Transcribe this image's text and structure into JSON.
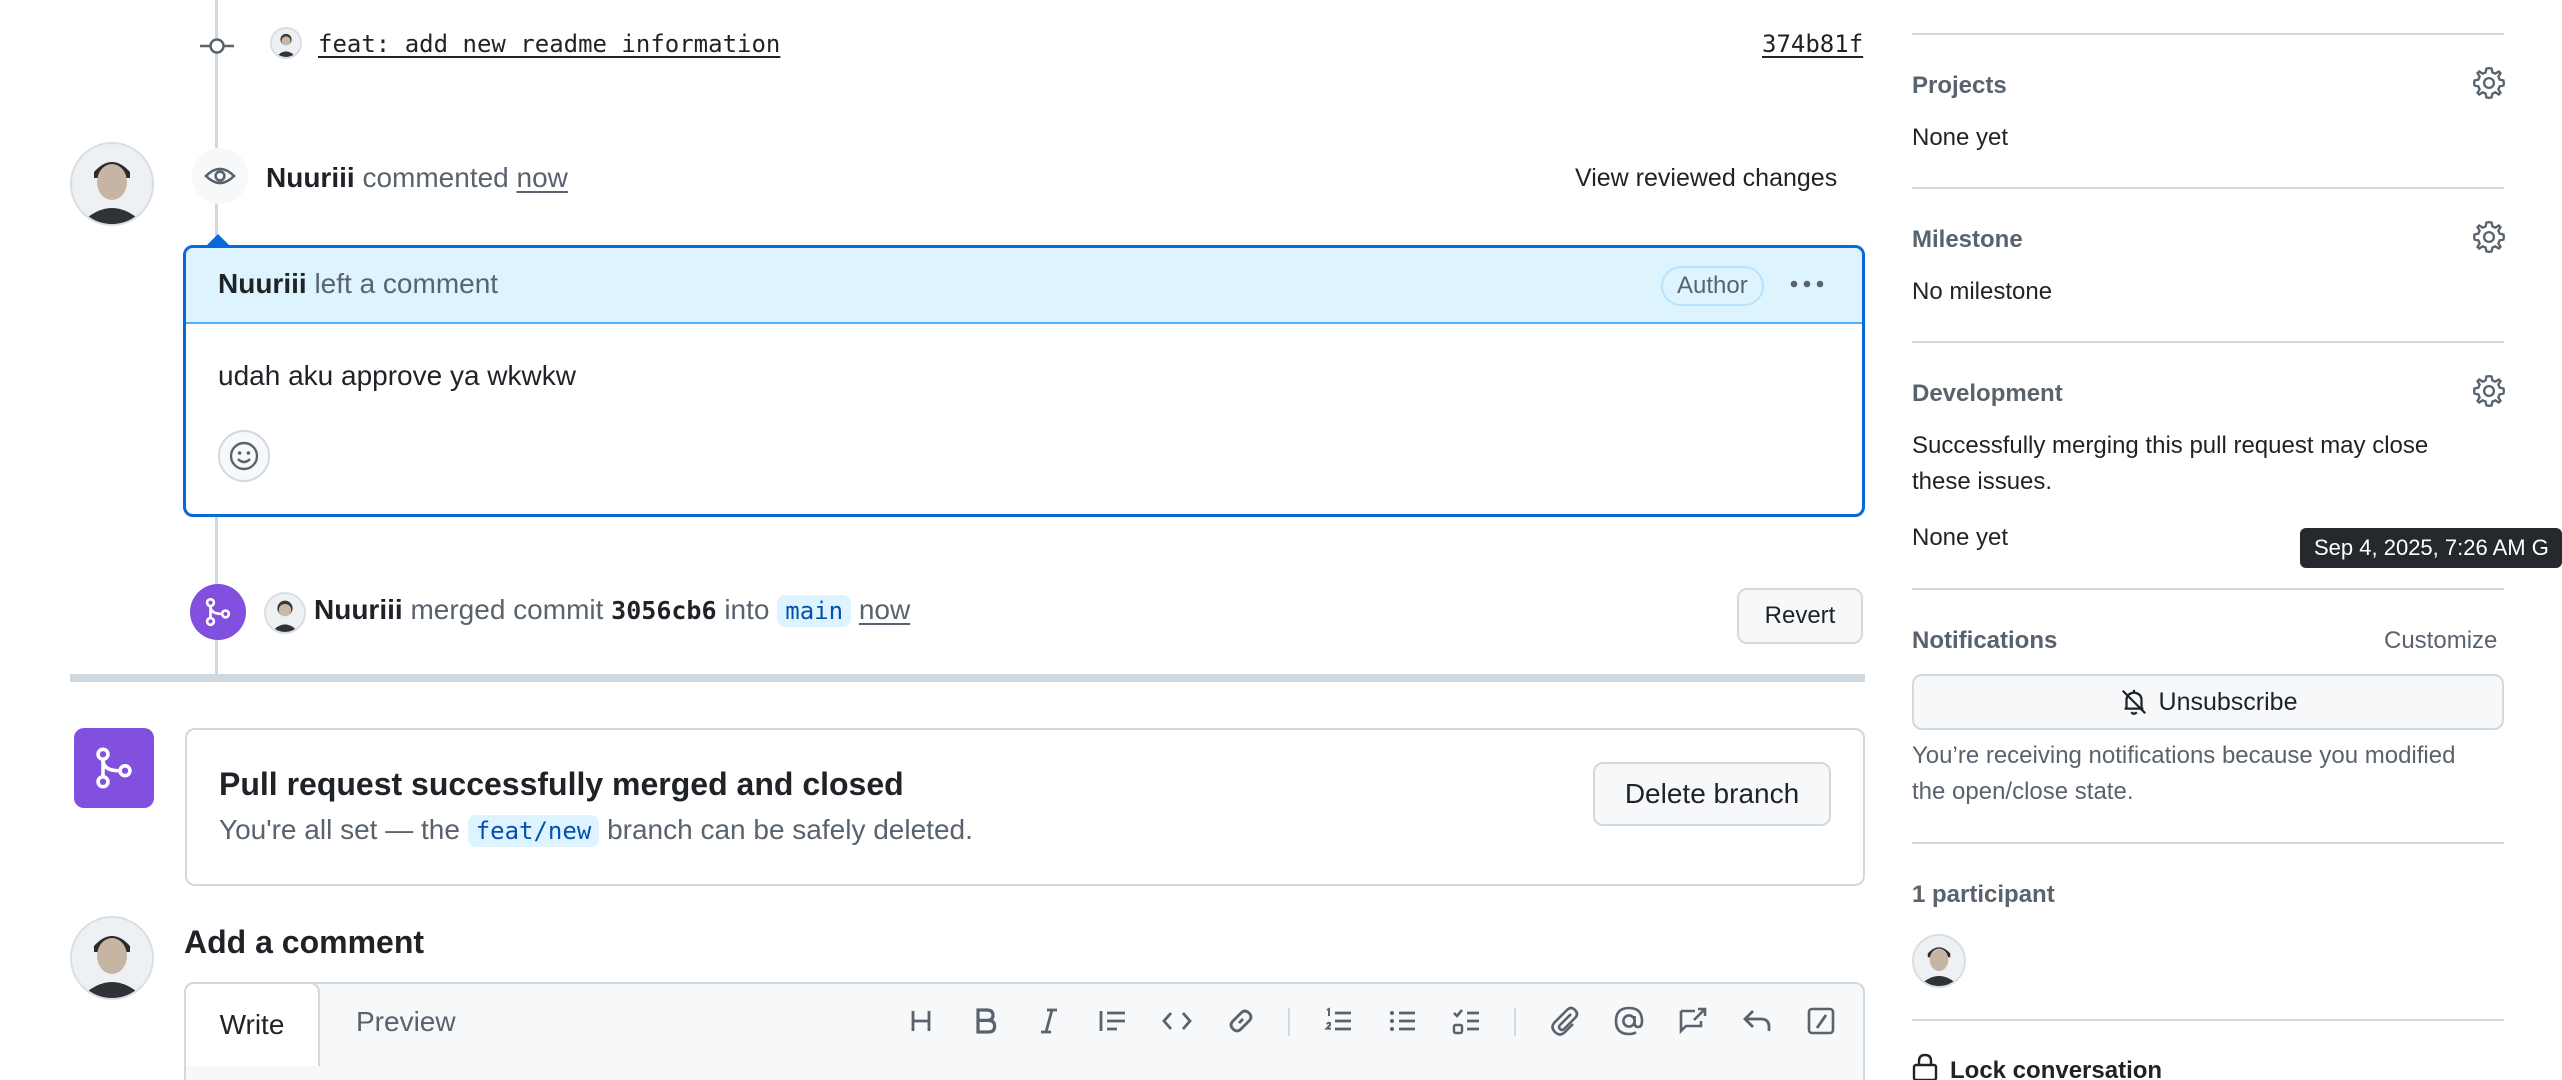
{
  "commit_row": {
    "message": "feat: add new readme information",
    "sha": "374b81f"
  },
  "review_event": {
    "author": "Nuuriii",
    "action": "commented",
    "time": "now",
    "view_changes_label": "View reviewed changes"
  },
  "comment": {
    "author": "Nuuriii",
    "header_suffix": "left a comment",
    "role_badge": "Author",
    "body": "udah aku approve ya wkwkw"
  },
  "merge_event": {
    "author": "Nuuriii",
    "action": "merged commit",
    "commit": "3056cb6",
    "into": "into",
    "branch": "main",
    "time": "now",
    "revert_label": "Revert"
  },
  "merged_box": {
    "title": "Pull request successfully merged and closed",
    "text_before": "You're all set — the",
    "branch": "feat/new",
    "text_after": "branch can be safely deleted.",
    "delete_label": "Delete branch"
  },
  "add_comment": {
    "title": "Add a comment",
    "tab_write": "Write",
    "tab_preview": "Preview"
  },
  "toolbar_icons": [
    "heading-icon",
    "bold-icon",
    "italic-icon",
    "quote-icon",
    "code-icon",
    "link-icon",
    "ordered-list-icon",
    "unordered-list-icon",
    "task-list-icon",
    "attach-icon",
    "mention-icon",
    "cross-reference-icon",
    "reply-icon",
    "slash-command-icon"
  ],
  "sidebar": {
    "projects": {
      "title": "Projects",
      "value": "None yet"
    },
    "milestone": {
      "title": "Milestone",
      "value": "No milestone"
    },
    "development": {
      "title": "Development",
      "description_line1": "Successfully merging this pull request may close",
      "description_line2": "these issues.",
      "value": "None yet"
    },
    "notifications": {
      "title": "Notifications",
      "customize_label": "Customize",
      "unsubscribe_label": "Unsubscribe",
      "note_line1": "You’re receiving notifications because you modified",
      "note_line2": "the open/close state."
    },
    "participants": {
      "title": "1 participant"
    },
    "lock_label": "Lock conversation"
  },
  "tooltip": "Sep 4, 2025, 7:26 AM G",
  "colors": {
    "accent_blue": "#0969da",
    "merged_purple": "#8250df",
    "comment_header_bg": "#ddf4ff"
  }
}
